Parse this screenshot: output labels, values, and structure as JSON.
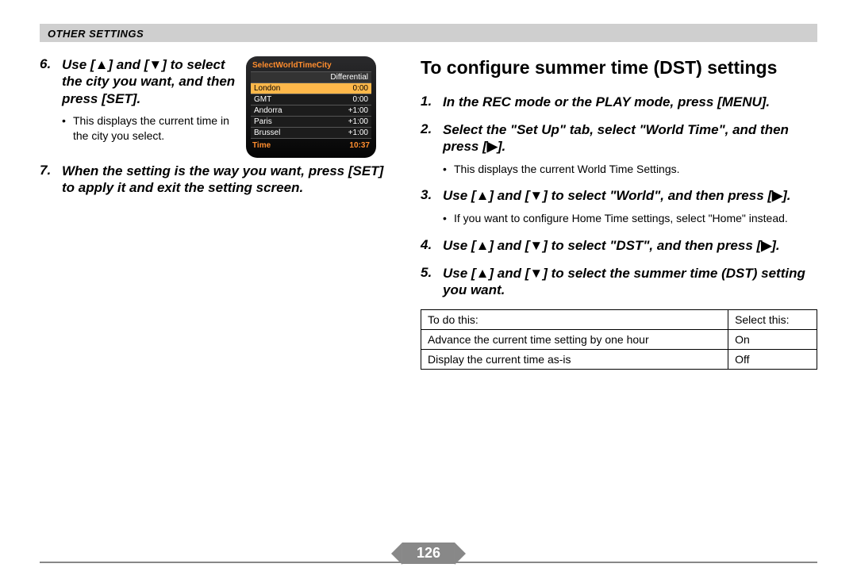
{
  "section_header": "OTHER SETTINGS",
  "page_number": "126",
  "symbols": {
    "up": "▲",
    "down": "▼",
    "right": "▶"
  },
  "left": {
    "step6": {
      "num": "6.",
      "parts": [
        "Use [",
        "▲",
        "] and [",
        "▼",
        "] to select the city you want, and then press [SET]."
      ],
      "bullet": "This displays the current time in the city you select."
    },
    "step7": {
      "num": "7.",
      "text": "When the setting is the way you want, press [SET] to apply it and exit the setting screen."
    }
  },
  "camera": {
    "title": "SelectWorldTimeCity",
    "header": "Differential",
    "rows": [
      {
        "city": "London",
        "diff": "0:00",
        "sel": true
      },
      {
        "city": "GMT",
        "diff": "0:00",
        "sel": false
      },
      {
        "city": "Andorra",
        "diff": "+1:00",
        "sel": false
      },
      {
        "city": "Paris",
        "diff": "+1:00",
        "sel": false
      },
      {
        "city": "Brussel",
        "diff": "+1:00",
        "sel": false
      }
    ],
    "footer_label": "Time",
    "footer_value": "10:37"
  },
  "right": {
    "title": "To configure summer time (DST) settings",
    "step1": {
      "num": "1.",
      "text": "In the REC mode or the PLAY mode, press [MENU]."
    },
    "step2": {
      "num": "2.",
      "parts": [
        "Select the \"Set Up\" tab, select \"World Time\", and then press [",
        "▶",
        "]."
      ],
      "bullet": "This displays the current World Time Settings."
    },
    "step3": {
      "num": "3.",
      "parts": [
        "Use [",
        "▲",
        "] and [",
        "▼",
        "] to select \"World\", and then press [",
        "▶",
        "]."
      ],
      "bullet": "If you want to configure Home Time settings, select \"Home\" instead."
    },
    "step4": {
      "num": "4.",
      "parts": [
        "Use [",
        "▲",
        "] and [",
        "▼",
        "] to select \"DST\", and then press [",
        "▶",
        "]."
      ]
    },
    "step5": {
      "num": "5.",
      "parts": [
        "Use [",
        "▲",
        "] and [",
        "▼",
        "] to select the summer time (DST) setting you want."
      ]
    }
  },
  "table": {
    "headers": [
      "To do this:",
      "Select this:"
    ],
    "rows": [
      {
        "c1": "Advance the current time setting by one hour",
        "c2": "On"
      },
      {
        "c1": "Display the current time as-is",
        "c2": "Off"
      }
    ]
  }
}
